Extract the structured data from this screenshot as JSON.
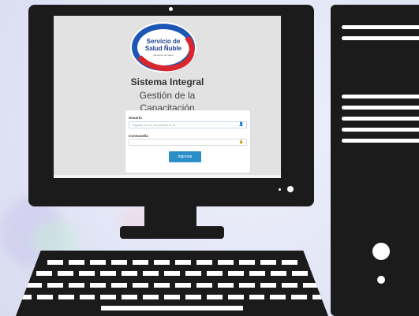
{
  "logo": {
    "line1": "Servicio de",
    "line2": "Salud Ñuble",
    "tagline": "Ministerio de Salud"
  },
  "app": {
    "title": "Sistema Integral",
    "subtitle_line1": "Gestión de la",
    "subtitle_line2": "Capacitación"
  },
  "login": {
    "user_label": "Usuario",
    "user_placeholder": "Ingrese su rut, sin puntos ni dv",
    "password_label": "Contraseña",
    "password_value": "",
    "submit_label": "Ingresar"
  },
  "icons": {
    "user_field": "user-icon",
    "password_field": "lock-icon"
  },
  "colors": {
    "device_black": "#1b1b1b",
    "button_blue": "#2a8fc9",
    "logo_blue": "#1d57b5",
    "logo_red": "#d8262c"
  }
}
